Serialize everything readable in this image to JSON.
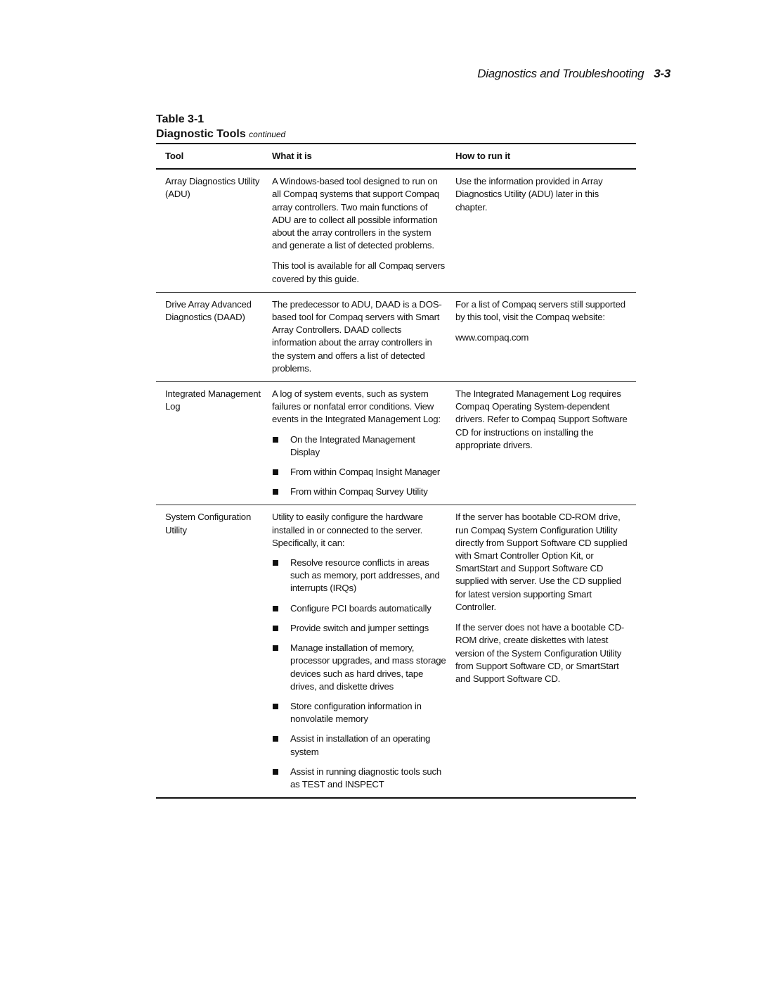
{
  "running_head": {
    "title": "Diagnostics and Troubleshooting",
    "page_number": "3-3"
  },
  "caption": {
    "table_number": "Table 3-1",
    "title": "Diagnostic Tools",
    "qualifier": "continued"
  },
  "table": {
    "headers": [
      "Tool",
      "What it is",
      "How to run it"
    ],
    "rows": [
      {
        "tool": "Array Diagnostics Utility (ADU)",
        "what": {
          "paragraphs": [
            "A Windows-based tool designed to run on all Compaq systems that support Compaq array controllers. Two main functions of ADU are to collect all possible information about the array controllers in the system and generate a list of detected problems.",
            "This tool is available for all Compaq servers covered by this guide."
          ],
          "bullets": []
        },
        "how": [
          "Use the information provided in Array Diagnostics Utility (ADU) later in this chapter."
        ]
      },
      {
        "tool": "Drive Array Advanced Diagnostics (DAAD)",
        "what": {
          "paragraphs": [
            "The predecessor to ADU, DAAD is a DOS-based tool for Compaq servers with Smart Array Controllers. DAAD collects information about the array controllers in the system and offers a list of detected problems."
          ],
          "bullets": []
        },
        "how": [
          "For a list of Compaq servers still supported by this tool, visit the Compaq website:",
          "www.compaq.com"
        ]
      },
      {
        "tool": "Integrated Management Log",
        "what": {
          "paragraphs": [
            "A log of system events, such as system failures or nonfatal error conditions. View events in the Integrated Management Log:"
          ],
          "bullets": [
            "On the Integrated Management Display",
            "From within Compaq Insight Manager",
            "From within Compaq Survey Utility"
          ]
        },
        "how": [
          "The Integrated Management Log requires Compaq Operating System-dependent drivers. Refer to Compaq Support Software CD for instructions on installing the appropriate drivers."
        ]
      },
      {
        "tool": "System Configuration Utility",
        "what": {
          "paragraphs": [
            "Utility to easily configure the hardware installed in or connected to the server. Specifically, it can:"
          ],
          "bullets": [
            "Resolve resource conflicts in areas such as memory, port addresses, and interrupts (IRQs)",
            "Configure PCI boards automatically",
            "Provide switch and jumper settings",
            "Manage installation of memory, processor upgrades, and mass storage devices such as hard drives, tape drives, and diskette drives",
            "Store configuration information in nonvolatile memory",
            "Assist in installation of an operating system",
            "Assist in running diagnostic tools such as TEST and INSPECT"
          ]
        },
        "how": [
          "If the server has bootable CD-ROM drive, run Compaq System Configuration Utility directly from Support Software CD supplied with Smart Controller Option Kit, or SmartStart and Support Software CD supplied with server. Use the CD supplied for latest version supporting Smart Controller.",
          "If the server does not have a bootable CD-ROM drive, create diskettes with latest version of the System Configuration Utility from Support Software CD, or SmartStart and Support Software CD."
        ]
      }
    ]
  }
}
